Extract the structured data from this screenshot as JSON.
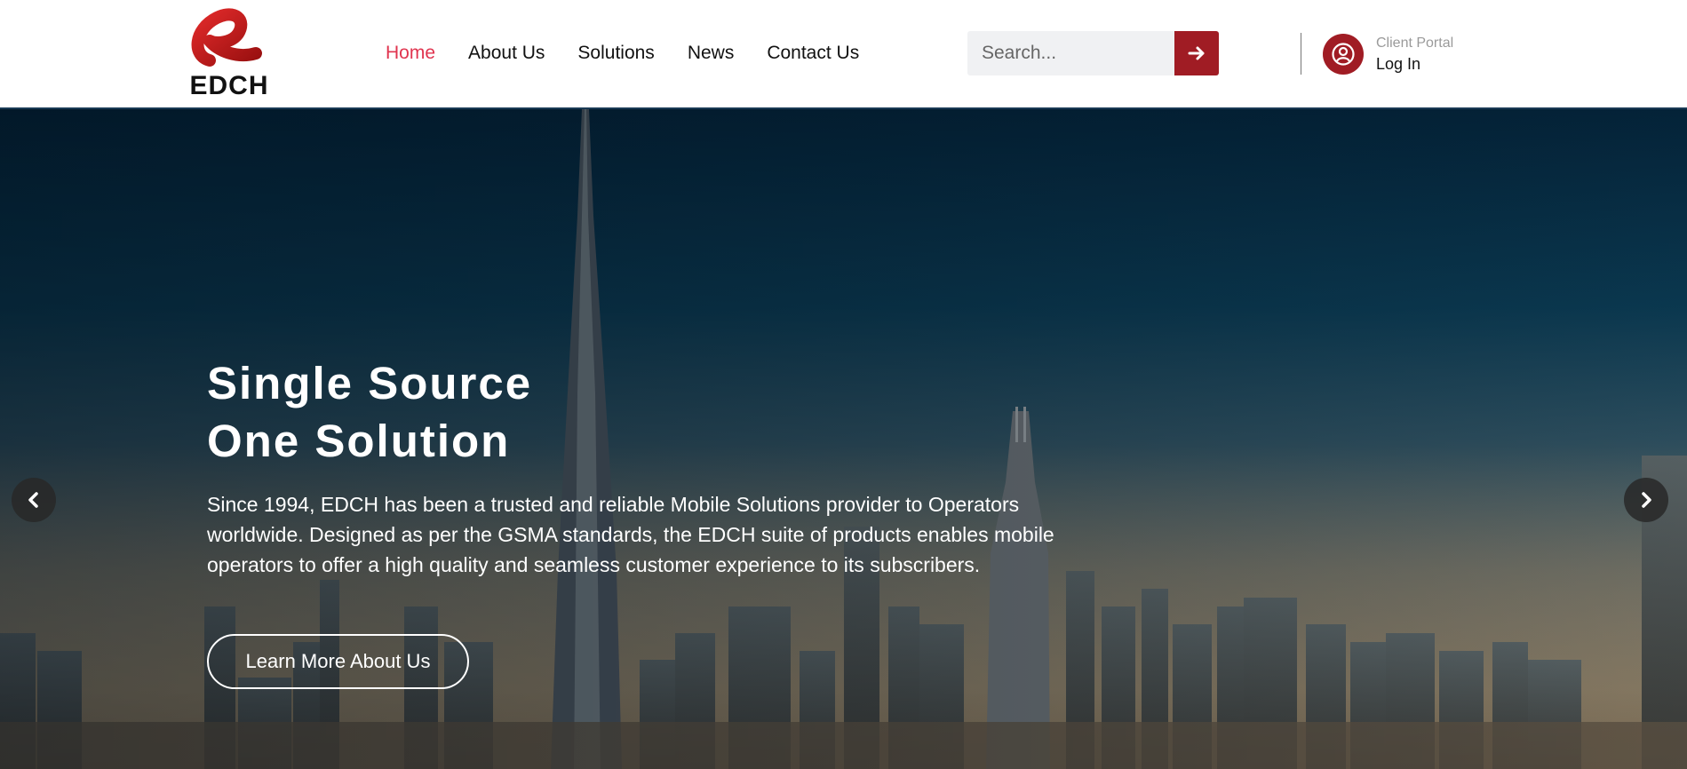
{
  "brand": {
    "name": "EDCH",
    "color": "#a01c24"
  },
  "nav": {
    "items": [
      {
        "label": "Home",
        "active": true
      },
      {
        "label": "About Us",
        "active": false
      },
      {
        "label": "Solutions",
        "active": false
      },
      {
        "label": "News",
        "active": false
      },
      {
        "label": "Contact Us",
        "active": false
      }
    ],
    "active_color": "#e0344f"
  },
  "search": {
    "placeholder": "Search...",
    "value": "",
    "button_icon": "arrow-right-icon"
  },
  "portal": {
    "sub_label": "Client Portal",
    "login_label": "Log In",
    "icon": "user-circle-icon"
  },
  "hero": {
    "title_line1": "Single Source",
    "title_line2": "One Solution",
    "description": "Since 1994, EDCH has been a trusted and reliable Mobile Solutions provider to Operators worldwide. Designed as per the GSMA standards, the EDCH suite of products enables mobile operators to offer a high quality and seamless customer experience to its subscribers.",
    "cta_label": "Learn More About Us",
    "prev_icon": "chevron-left-icon",
    "next_icon": "chevron-right-icon"
  }
}
